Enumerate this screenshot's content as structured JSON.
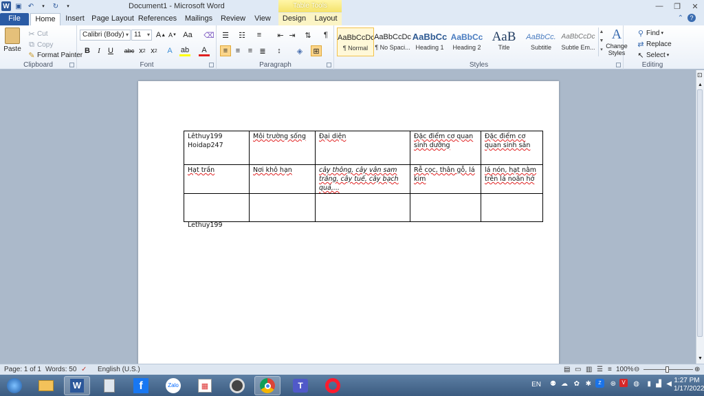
{
  "window": {
    "title": "Document1  -  Microsoft Word",
    "context_tab_group": "Table Tools",
    "controls": [
      "minimize",
      "restore",
      "close"
    ]
  },
  "tabs": [
    {
      "label": "File"
    },
    {
      "label": "Home"
    },
    {
      "label": "Insert"
    },
    {
      "label": "Page Layout"
    },
    {
      "label": "References"
    },
    {
      "label": "Mailings"
    },
    {
      "label": "Review"
    },
    {
      "label": "View"
    },
    {
      "label": "Design"
    },
    {
      "label": "Layout"
    }
  ],
  "ribbon": {
    "clipboard": {
      "label": "Clipboard",
      "paste": "Paste",
      "cut": "Cut",
      "copy": "Copy",
      "format_painter": "Format Painter"
    },
    "font": {
      "label": "Font",
      "font_name": "Calibri (Body)",
      "font_size": "11"
    },
    "paragraph": {
      "label": "Paragraph"
    },
    "styles": {
      "label": "Styles",
      "items": [
        {
          "preview": "AaBbCcDc",
          "name": "¶ Normal"
        },
        {
          "preview": "AaBbCcDc",
          "name": "¶ No Spaci..."
        },
        {
          "preview": "AaBbCc",
          "name": "Heading 1"
        },
        {
          "preview": "AaBbCc",
          "name": "Heading 2"
        },
        {
          "preview": "AaB",
          "name": "Title"
        },
        {
          "preview": "AaBbCc.",
          "name": "Subtitle"
        },
        {
          "preview": "AaBbCcDc",
          "name": "Subtle Em..."
        }
      ],
      "change_styles": "Change Styles"
    },
    "editing": {
      "label": "Editing",
      "find": "Find",
      "replace": "Replace",
      "select": "Select"
    }
  },
  "document": {
    "table": [
      [
        "Lêthuy199\nHoidap247",
        "Môi trường  sống",
        "Đại diện",
        "Đặc điểm  cơ quan sinh dưỡng",
        "Đặc điểm  cơ quan sinh sản"
      ],
      [
        "Hạt trần",
        "Nơi khô hạn",
        " cây thông,  cây vân sam trắng,  cây tuế,  cây bạch quả,...",
        "Rễ cọc, thân gỗ, lá kim",
        " lá nón, hạt nằm trên lá noãn hở"
      ],
      [
        "",
        "",
        "",
        "",
        ""
      ]
    ],
    "after_text": "Lethuy199"
  },
  "status": {
    "page": "Page: 1 of 1",
    "words": "Words: 50",
    "language": "English (U.S.)",
    "zoom": "100%"
  },
  "taskbar": {
    "apps": [
      "start",
      "file-explorer",
      "word",
      "calculator",
      "facebook",
      "zalo",
      "paint",
      "camera",
      "chrome",
      "teams",
      "opera"
    ],
    "language": "EN",
    "time": "1:27 PM",
    "date": "1/17/2022"
  }
}
